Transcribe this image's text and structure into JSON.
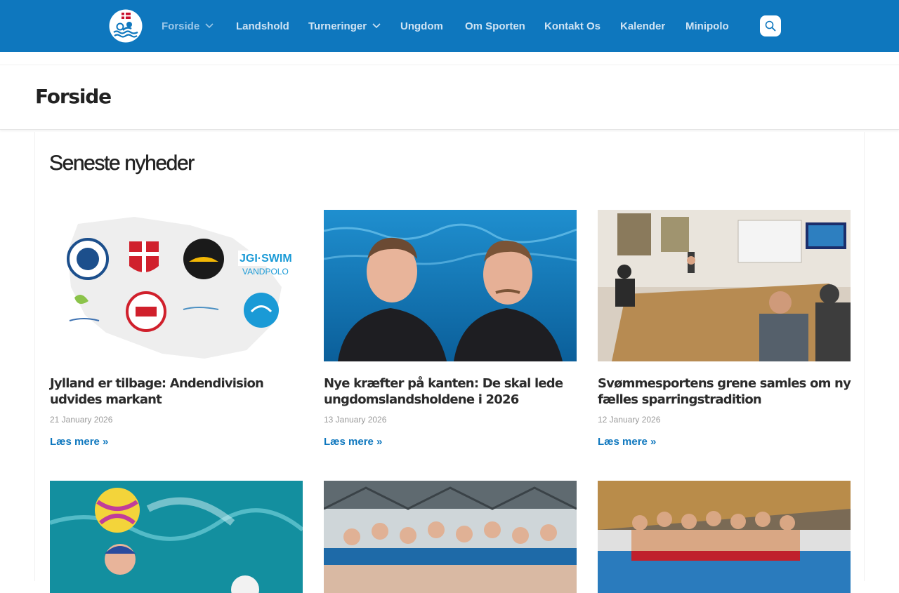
{
  "nav": {
    "items": [
      {
        "label": "Forside",
        "dropdown": true,
        "active": true
      },
      {
        "label": "Landshold",
        "dropdown": false
      },
      {
        "label": "Turneringer",
        "dropdown": true
      },
      {
        "label": "Ungdom",
        "dropdown": false
      },
      {
        "label": "Om Sporten",
        "dropdown": false
      },
      {
        "label": "Kontakt Os",
        "dropdown": false
      },
      {
        "label": "Kalender",
        "dropdown": false
      },
      {
        "label": "Minipolo",
        "dropdown": false
      }
    ],
    "search_icon": "search-icon"
  },
  "page": {
    "title": "Forside"
  },
  "news": {
    "heading": "Seneste nyheder",
    "more_label": "Læs mere »",
    "articles": [
      {
        "title": "Jylland er tilbage: Andendivision udvides markant",
        "date": "21 January 2026"
      },
      {
        "title": "Nye kræfter på kanten: De skal lede ungdomslandsholdene i 2026",
        "date": "13 January 2026"
      },
      {
        "title": "Svømmesportens grene samles om ny fælles sparringstradition",
        "date": "12 January 2026"
      }
    ]
  },
  "colors": {
    "brand": "#0e77be",
    "text": "#222222",
    "muted": "#9a9a9a"
  }
}
